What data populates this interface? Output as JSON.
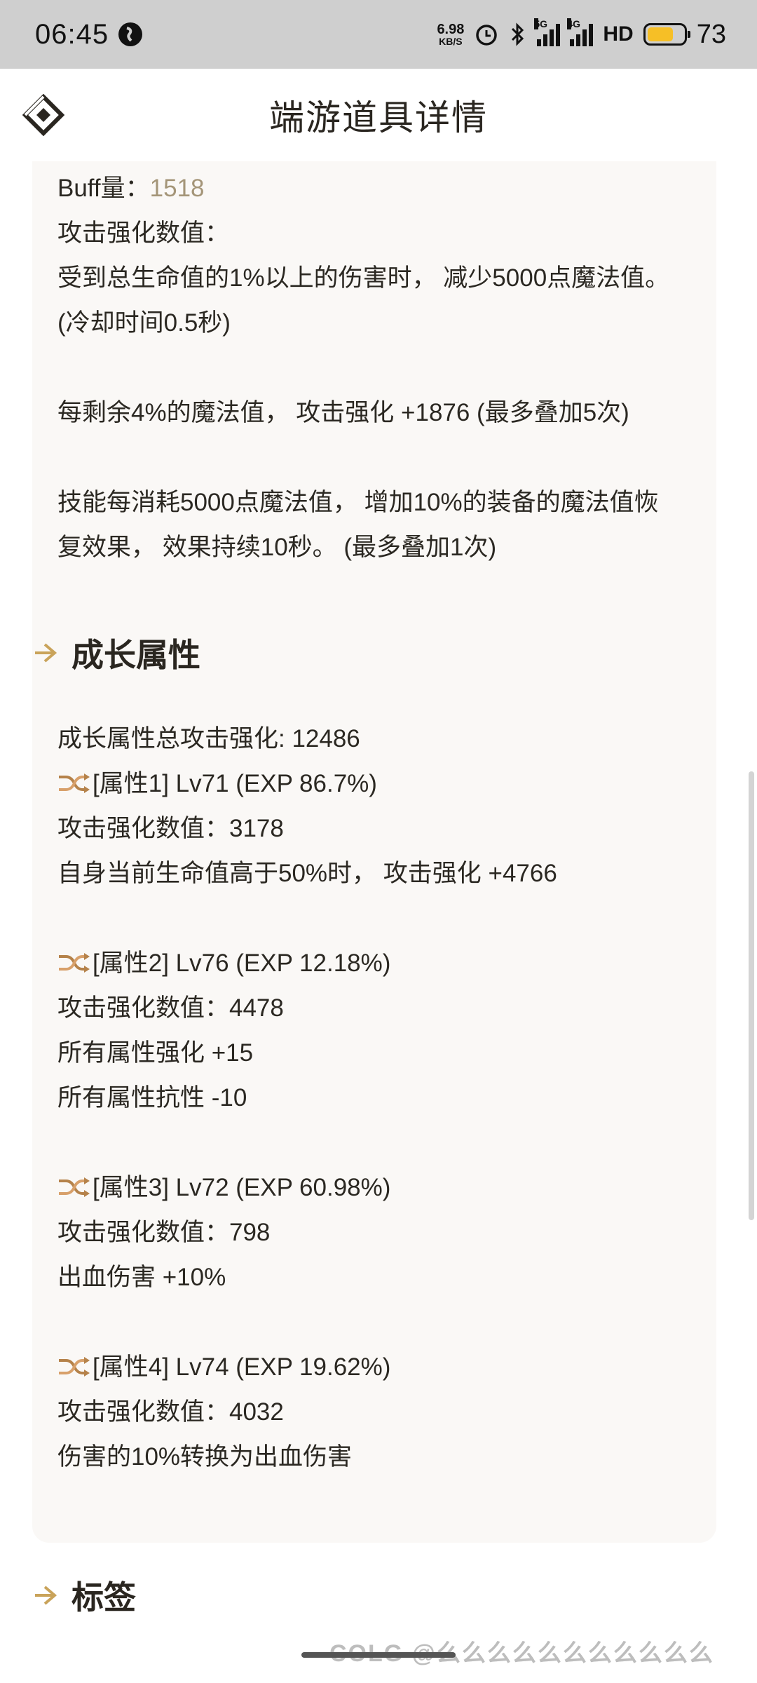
{
  "status_bar": {
    "time": "06:45",
    "net_speed_value": "6.98",
    "net_speed_unit": "KB/S",
    "signal_1_tag": "5G",
    "signal_2_tag": "4G",
    "hd_label": "HD",
    "battery_level": "73"
  },
  "header": {
    "title": "端游道具详情"
  },
  "card1": {
    "buff_label": "Buff量：",
    "buff_value": "1518",
    "lines": [
      "攻击强化数值：",
      "受到总生命值的1%以上的伤害时， 减少5000点魔法值。",
      "(冷却时间0.5秒)",
      "每剩余4%的魔法值， 攻击强化 +1876 (最多叠加5次)",
      "技能每消耗5000点魔法值， 增加10%的装备的魔法值恢",
      "复效果， 效果持续10秒。 (最多叠加1次)"
    ]
  },
  "growth_section": {
    "title": "成长属性",
    "total": "成长属性总攻击强化: 12486",
    "attr1": {
      "header": "[属性1] Lv71 (EXP 86.7%)",
      "value": "攻击强化数值：3178",
      "effects": [
        "自身当前生命值高于50%时， 攻击强化 +4766"
      ]
    },
    "attr2": {
      "header": "[属性2] Lv76 (EXP 12.18%)",
      "value": "攻击强化数值：4478",
      "effects": [
        "所有属性强化 +15",
        "所有属性抗性 -10"
      ]
    },
    "attr3": {
      "header": "[属性3] Lv72 (EXP 60.98%)",
      "value": "攻击强化数值：798",
      "effects": [
        "出血伤害 +10%"
      ]
    },
    "attr4": {
      "header": "[属性4] Lv74 (EXP 19.62%)",
      "value": "攻击强化数值：4032",
      "effects": [
        "伤害的10%转换为出血伤害"
      ]
    }
  },
  "tags_section": {
    "title": "标签"
  },
  "watermark": "COLG @么么么么么么么么么么么"
}
